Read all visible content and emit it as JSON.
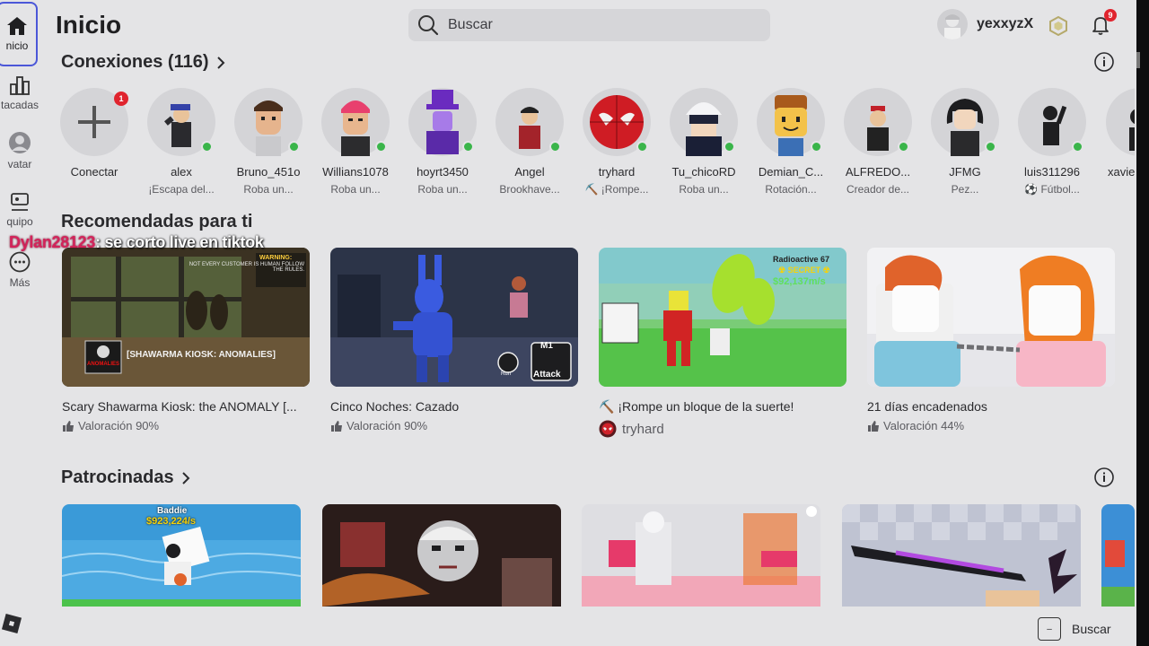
{
  "nav": {
    "items": [
      {
        "label": "nicio"
      },
      {
        "label": "tacadas"
      },
      {
        "label": "vatar"
      },
      {
        "label": "quipo"
      },
      {
        "label": "Más"
      }
    ]
  },
  "header": {
    "title": "Inicio",
    "search_placeholder": "Buscar",
    "username": "yexxyzX",
    "notification_count": "9"
  },
  "connections": {
    "title": "Conexiones (116)",
    "connect_label": "Conectar",
    "connect_badge": "1",
    "items": [
      {
        "name": "alex",
        "status": "¡Escapa del..."
      },
      {
        "name": "Bruno_451o",
        "status": "Roba un..."
      },
      {
        "name": "Willians1078",
        "status": "Roba un..."
      },
      {
        "name": "hoyrt3450",
        "status": "Roba un..."
      },
      {
        "name": "Angel",
        "status": "Brookhave..."
      },
      {
        "name": "tryhard",
        "status": "⛏️ ¡Rompe..."
      },
      {
        "name": "Tu_chicoRD",
        "status": "Roba un..."
      },
      {
        "name": "Demian_C...",
        "status": "Rotación..."
      },
      {
        "name": "ALFREDO...",
        "status": "Creador de..."
      },
      {
        "name": "JFMG",
        "status": "Pez..."
      },
      {
        "name": "luis311296",
        "status": "⚽ Fútbol..."
      },
      {
        "name": "xavie",
        "status": ""
      }
    ]
  },
  "chat": {
    "user": "Dylan28123",
    "message": ": se corto live en tiktok"
  },
  "recommended": {
    "title": "Recomendadas para ti",
    "games": [
      {
        "title": "Scary Shawarma Kiosk: the ANOMALY [...",
        "meta": "Valoración 90%"
      },
      {
        "title": "Cinco Noches: Cazado",
        "meta": "Valoración 90%"
      },
      {
        "title": "⛏️ ¡Rompe un bloque de la suerte!",
        "meta": "tryhard"
      },
      {
        "title": "21 días encadenados",
        "meta": "Valoración 44%"
      }
    ],
    "thumb_text": {
      "g1_title": "[SHAWARMA KIOSK: ANOMALIES]",
      "g1_warning": "WARNING:",
      "g1_note": "NOT EVERY CUSTOMER IS HUMAN FOLLOW THE RULES.",
      "g1_sign": "ANOMALIES",
      "g2_button": "Attack",
      "g2_key": "M1",
      "g2_run": "Run",
      "g3_radio": "Radioactive 67",
      "g3_secret": "☢ SECRET ☢",
      "g3_rate": "$92,137m/s"
    }
  },
  "sponsored": {
    "title": "Patrocinadas",
    "first_label": "Baddie",
    "first_rate": "$923,224/s"
  },
  "footer": {
    "search_label": "Buscar"
  }
}
